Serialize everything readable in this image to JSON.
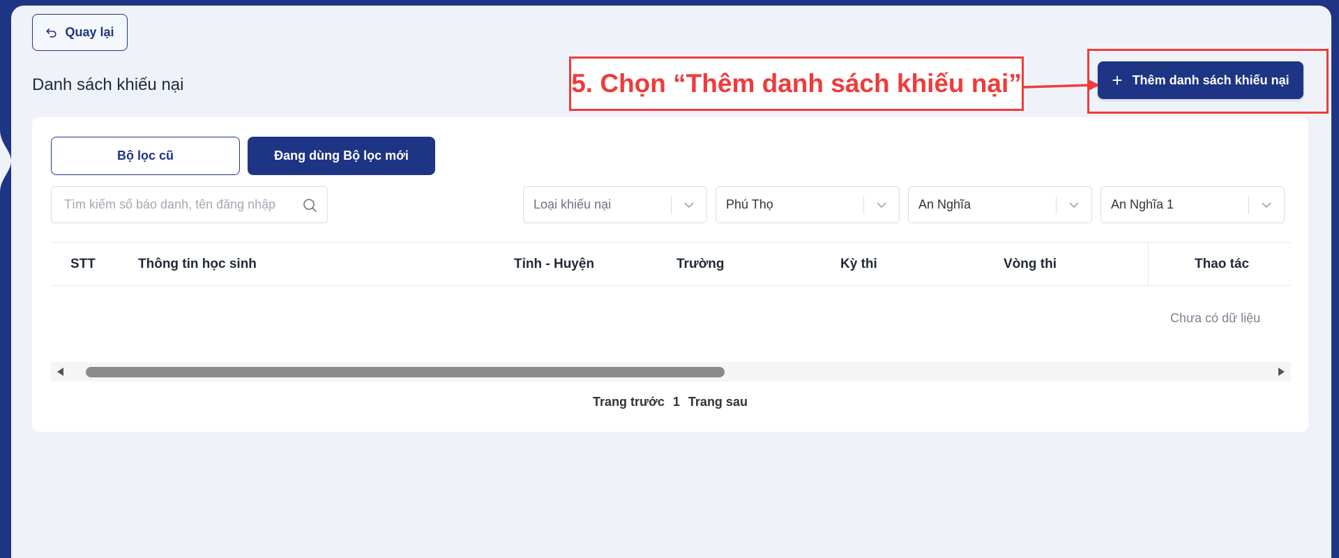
{
  "header": {
    "back_label": "Quay lại",
    "page_title": "Danh sách khiếu nại",
    "add_button_label": "Thêm danh sách khiếu nại"
  },
  "annotation": {
    "text": "5. Chọn “Thêm danh sách khiếu nại”",
    "color": "#ef3b3b"
  },
  "filters": {
    "tabs": [
      {
        "label": "Bộ lọc cũ",
        "active": false
      },
      {
        "label": "Đang dùng Bộ lọc mới",
        "active": true
      }
    ],
    "search_placeholder": "Tìm kiếm số báo danh, tên đăng nhập",
    "selects": [
      {
        "value": "Loại khiếu nại",
        "is_placeholder": true
      },
      {
        "value": "Phú Thọ",
        "is_placeholder": false
      },
      {
        "value": "An Nghĩa",
        "is_placeholder": false
      },
      {
        "value": "An Nghĩa 1",
        "is_placeholder": false
      }
    ]
  },
  "table": {
    "columns": [
      "STT",
      "Thông tin học sinh",
      "Tỉnh - Huyện",
      "Trường",
      "Kỳ thi",
      "Vòng thi",
      "Thao tác"
    ],
    "empty_text": "Chưa có dữ liệu",
    "rows": []
  },
  "pagination": {
    "prev_label": "Trang trước",
    "current_page": "1",
    "next_label": "Trang sau"
  },
  "colors": {
    "brand": "#1e3485",
    "background": "#eff3f9",
    "annotation": "#ef3b3b"
  },
  "icons": [
    "back-arrow-icon",
    "plus-icon",
    "search-icon",
    "chevron-down-icon",
    "scroll-left-icon",
    "scroll-right-icon"
  ]
}
